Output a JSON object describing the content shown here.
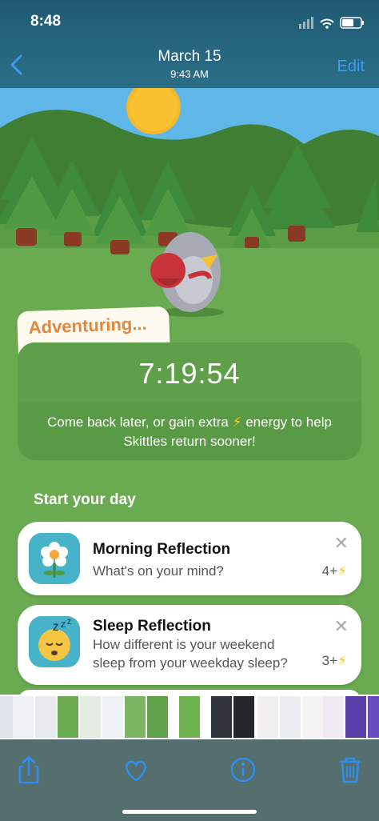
{
  "status": {
    "time": "8:48"
  },
  "nav": {
    "date": "March 15",
    "time": "9:43 AM",
    "edit_label": "Edit"
  },
  "adventure": {
    "tag": "Adventuring...",
    "timer": "7:19:54",
    "message_before": "Come back later, or gain extra ",
    "message_after": " energy to help Skittles return sooner!"
  },
  "section": {
    "title": "Start your day"
  },
  "cards": [
    {
      "title": "Morning Reflection",
      "subtitle": "What's on your mind?",
      "energy": "4+"
    },
    {
      "title": "Sleep Reflection",
      "subtitle": "How different is your weekend sleep from your weekday sleep?",
      "energy": "3+"
    }
  ],
  "icons": {
    "back": "chevron-left-icon",
    "share": "share-icon",
    "like": "heart-icon",
    "info": "info-icon",
    "delete": "trash-icon"
  },
  "colors": {
    "accent": "#3d9cf2",
    "adventure": "#e2873e",
    "energy": "#f7c62f"
  }
}
